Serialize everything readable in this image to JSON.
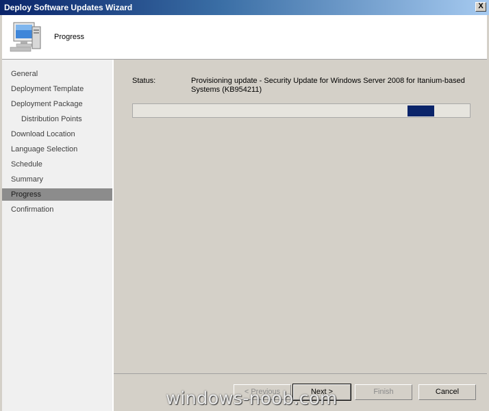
{
  "window": {
    "title": "Deploy Software Updates Wizard",
    "close_label": "X"
  },
  "header": {
    "title": "Progress",
    "icon": "computer-monitor-icon"
  },
  "nav": {
    "items": [
      {
        "label": "General",
        "sub": false,
        "active": false
      },
      {
        "label": "Deployment Template",
        "sub": false,
        "active": false
      },
      {
        "label": "Deployment Package",
        "sub": false,
        "active": false
      },
      {
        "label": "Distribution Points",
        "sub": true,
        "active": false
      },
      {
        "label": "Download Location",
        "sub": false,
        "active": false
      },
      {
        "label": "Language Selection",
        "sub": false,
        "active": false
      },
      {
        "label": "Schedule",
        "sub": false,
        "active": false
      },
      {
        "label": "Summary",
        "sub": false,
        "active": false
      },
      {
        "label": "Progress",
        "sub": false,
        "active": true
      },
      {
        "label": "Confirmation",
        "sub": false,
        "active": false
      }
    ]
  },
  "main": {
    "status_label": "Status:",
    "status_text": "Provisioning update - Security Update for Windows Server 2008 for Itanium-based Systems (KB954211)",
    "progress_marquee_position": 0.855
  },
  "buttons": {
    "previous": "< Previous",
    "next": "Next >",
    "finish": "Finish",
    "cancel": "Cancel"
  },
  "watermark": "windows-noob.com",
  "colors": {
    "progress_chunk": "#0a246a",
    "active_nav": "#8c8c8c"
  }
}
